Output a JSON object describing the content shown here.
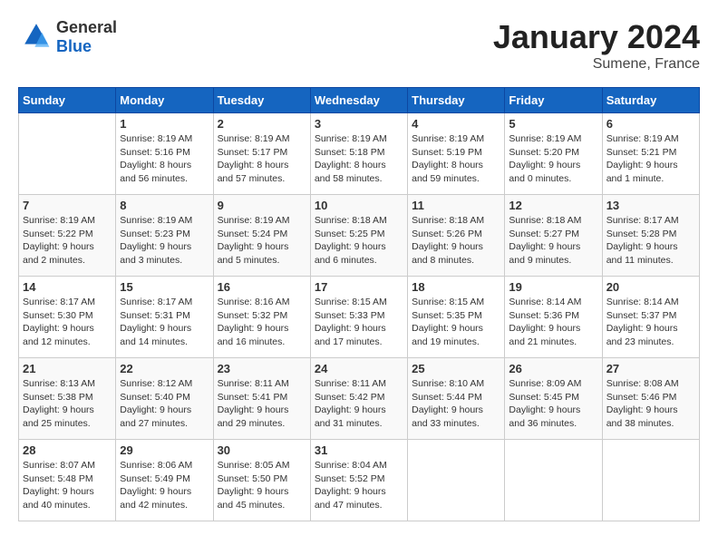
{
  "header": {
    "logo_general": "General",
    "logo_blue": "Blue",
    "month_title": "January 2024",
    "location": "Sumene, France"
  },
  "days_of_week": [
    "Sunday",
    "Monday",
    "Tuesday",
    "Wednesday",
    "Thursday",
    "Friday",
    "Saturday"
  ],
  "weeks": [
    [
      {
        "day": "",
        "info": ""
      },
      {
        "day": "1",
        "info": "Sunrise: 8:19 AM\nSunset: 5:16 PM\nDaylight: 8 hours\nand 56 minutes."
      },
      {
        "day": "2",
        "info": "Sunrise: 8:19 AM\nSunset: 5:17 PM\nDaylight: 8 hours\nand 57 minutes."
      },
      {
        "day": "3",
        "info": "Sunrise: 8:19 AM\nSunset: 5:18 PM\nDaylight: 8 hours\nand 58 minutes."
      },
      {
        "day": "4",
        "info": "Sunrise: 8:19 AM\nSunset: 5:19 PM\nDaylight: 8 hours\nand 59 minutes."
      },
      {
        "day": "5",
        "info": "Sunrise: 8:19 AM\nSunset: 5:20 PM\nDaylight: 9 hours\nand 0 minutes."
      },
      {
        "day": "6",
        "info": "Sunrise: 8:19 AM\nSunset: 5:21 PM\nDaylight: 9 hours\nand 1 minute."
      }
    ],
    [
      {
        "day": "7",
        "info": "Sunrise: 8:19 AM\nSunset: 5:22 PM\nDaylight: 9 hours\nand 2 minutes."
      },
      {
        "day": "8",
        "info": "Sunrise: 8:19 AM\nSunset: 5:23 PM\nDaylight: 9 hours\nand 3 minutes."
      },
      {
        "day": "9",
        "info": "Sunrise: 8:19 AM\nSunset: 5:24 PM\nDaylight: 9 hours\nand 5 minutes."
      },
      {
        "day": "10",
        "info": "Sunrise: 8:18 AM\nSunset: 5:25 PM\nDaylight: 9 hours\nand 6 minutes."
      },
      {
        "day": "11",
        "info": "Sunrise: 8:18 AM\nSunset: 5:26 PM\nDaylight: 9 hours\nand 8 minutes."
      },
      {
        "day": "12",
        "info": "Sunrise: 8:18 AM\nSunset: 5:27 PM\nDaylight: 9 hours\nand 9 minutes."
      },
      {
        "day": "13",
        "info": "Sunrise: 8:17 AM\nSunset: 5:28 PM\nDaylight: 9 hours\nand 11 minutes."
      }
    ],
    [
      {
        "day": "14",
        "info": "Sunrise: 8:17 AM\nSunset: 5:30 PM\nDaylight: 9 hours\nand 12 minutes."
      },
      {
        "day": "15",
        "info": "Sunrise: 8:17 AM\nSunset: 5:31 PM\nDaylight: 9 hours\nand 14 minutes."
      },
      {
        "day": "16",
        "info": "Sunrise: 8:16 AM\nSunset: 5:32 PM\nDaylight: 9 hours\nand 16 minutes."
      },
      {
        "day": "17",
        "info": "Sunrise: 8:15 AM\nSunset: 5:33 PM\nDaylight: 9 hours\nand 17 minutes."
      },
      {
        "day": "18",
        "info": "Sunrise: 8:15 AM\nSunset: 5:35 PM\nDaylight: 9 hours\nand 19 minutes."
      },
      {
        "day": "19",
        "info": "Sunrise: 8:14 AM\nSunset: 5:36 PM\nDaylight: 9 hours\nand 21 minutes."
      },
      {
        "day": "20",
        "info": "Sunrise: 8:14 AM\nSunset: 5:37 PM\nDaylight: 9 hours\nand 23 minutes."
      }
    ],
    [
      {
        "day": "21",
        "info": "Sunrise: 8:13 AM\nSunset: 5:38 PM\nDaylight: 9 hours\nand 25 minutes."
      },
      {
        "day": "22",
        "info": "Sunrise: 8:12 AM\nSunset: 5:40 PM\nDaylight: 9 hours\nand 27 minutes."
      },
      {
        "day": "23",
        "info": "Sunrise: 8:11 AM\nSunset: 5:41 PM\nDaylight: 9 hours\nand 29 minutes."
      },
      {
        "day": "24",
        "info": "Sunrise: 8:11 AM\nSunset: 5:42 PM\nDaylight: 9 hours\nand 31 minutes."
      },
      {
        "day": "25",
        "info": "Sunrise: 8:10 AM\nSunset: 5:44 PM\nDaylight: 9 hours\nand 33 minutes."
      },
      {
        "day": "26",
        "info": "Sunrise: 8:09 AM\nSunset: 5:45 PM\nDaylight: 9 hours\nand 36 minutes."
      },
      {
        "day": "27",
        "info": "Sunrise: 8:08 AM\nSunset: 5:46 PM\nDaylight: 9 hours\nand 38 minutes."
      }
    ],
    [
      {
        "day": "28",
        "info": "Sunrise: 8:07 AM\nSunset: 5:48 PM\nDaylight: 9 hours\nand 40 minutes."
      },
      {
        "day": "29",
        "info": "Sunrise: 8:06 AM\nSunset: 5:49 PM\nDaylight: 9 hours\nand 42 minutes."
      },
      {
        "day": "30",
        "info": "Sunrise: 8:05 AM\nSunset: 5:50 PM\nDaylight: 9 hours\nand 45 minutes."
      },
      {
        "day": "31",
        "info": "Sunrise: 8:04 AM\nSunset: 5:52 PM\nDaylight: 9 hours\nand 47 minutes."
      },
      {
        "day": "",
        "info": ""
      },
      {
        "day": "",
        "info": ""
      },
      {
        "day": "",
        "info": ""
      }
    ]
  ]
}
